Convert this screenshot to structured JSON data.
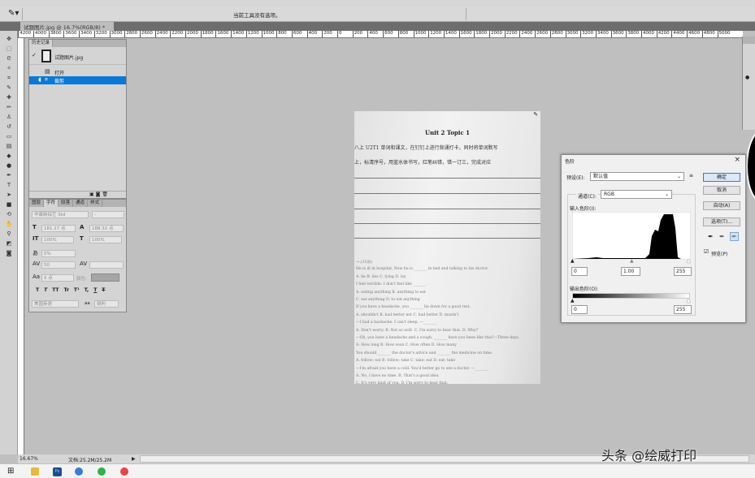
{
  "options_bar": {
    "hint": "当前工具没有选项。"
  },
  "document_tab": {
    "title": "试题图片.jpg @ 16.7%(RGB/8) *",
    "close": "×"
  },
  "ruler": {
    "labels": [
      "4400",
      "4200",
      "4000",
      "3800",
      "3600",
      "3400",
      "3200",
      "3000",
      "2800",
      "2600",
      "2400",
      "2200",
      "2000",
      "1800",
      "1600",
      "1400",
      "1200",
      "1000",
      "800",
      "600",
      "400",
      "200",
      "0",
      "200",
      "400",
      "600",
      "800",
      "1000",
      "1200",
      "1400",
      "1600",
      "1800",
      "2000",
      "2200",
      "2400",
      "2600",
      "2800",
      "3000",
      "3200",
      "3400",
      "3600",
      "3800",
      "4000",
      "4200",
      "4400",
      "4600",
      "4800",
      "5000"
    ]
  },
  "history_panel": {
    "tab": "历史记录",
    "snapshot": "试题图片.jpg",
    "items": [
      {
        "label": "打开",
        "selected": false
      },
      {
        "label": "裁剪",
        "selected": true
      }
    ]
  },
  "character_panel": {
    "tabs": [
      "图层",
      "字符",
      "段落",
      "通道",
      "样式"
    ],
    "active_tab": "字符",
    "font_family": "华康新综艺 Std",
    "font_style": "-",
    "font_size": "181.17 点",
    "leading": "188.32 点",
    "vertical_scale": "100%",
    "horizontal_scale": "100%",
    "tsume": "0%",
    "tracking": "50",
    "baseline_shift": "0 点",
    "color_label": "颜色:",
    "style_buttons": [
      "T",
      "T",
      "TT",
      "Tr",
      "T¹",
      "T,",
      "T",
      "T"
    ],
    "language": "美国英语",
    "antialias": "锐利",
    "aa_label": "aa"
  },
  "document": {
    "title": "Unit 2 Topic 1",
    "instructions": [
      "八上 U2T1 单词和课文，在钉钉上进行背诵打卡，同时将单词默写",
      "上，标清序号，用蓝水体书写，红笔纠错，错一订三，完成对应"
    ],
    "questions": [
      "一.(15分)",
      "He is ill in hospital. Now he is _______ in bed and talking to his doctor.",
      "A. lie          B. lies          C. lying          D. lay",
      "I feel terrible. I don't feel like _______.",
      "A. eating anything                         B. anything to eat",
      "C. eat anything                            D. to eat anything",
      "If you have a headache, you _______ lie down for a good rest.",
      "A. shouldn't       B. had better not       C. had better       D. mustn't",
      "—I had a backache. I can't sleep.  —_______",
      "A. Don't worry.     B. Not so well.     C. I'm sorry to hear that.   D. Why?",
      "—Oh, you have a headache and a cough. _______ have you been like this?—Three days.",
      "A. How long       B. How soon       C. How often       D. How many",
      "You should _______ the doctor's advice and _______ the medicine on time.",
      "A. follow; eat       B. follow; take       C. take; eat       D. eat; take",
      "—I'm afraid you have a cold. You'd better go to see a doctor.  —_______",
      "A. No, I have no time.                     B. That's a good idea.",
      "C. It's very kind of you.                  D. I'm sorry to hear that."
    ]
  },
  "levels_dialog": {
    "title": "色阶",
    "close": "×",
    "preset_label": "预设(E):",
    "preset_value": "默认值",
    "channel_label": "通道(C):",
    "channel_value": "RGB",
    "input_levels_label": "输入色阶(I):",
    "input_black": "0",
    "input_gamma": "1.00",
    "input_white": "255",
    "output_levels_label": "输出色阶(O):",
    "output_black": "0",
    "output_white": "255",
    "buttons": {
      "ok": "确定",
      "cancel": "取消",
      "auto": "自动(A)",
      "options": "选项(T)..."
    },
    "preview_label": "预览(P)",
    "preview_checked": true
  },
  "status_bar": {
    "zoom": "16.67%",
    "doc_size": "文档:25.2M/25.2M"
  },
  "watermark": "头条 @绘威打印",
  "colors": {
    "selection": "#0a78d7",
    "canvas": "#bfbfbf"
  }
}
